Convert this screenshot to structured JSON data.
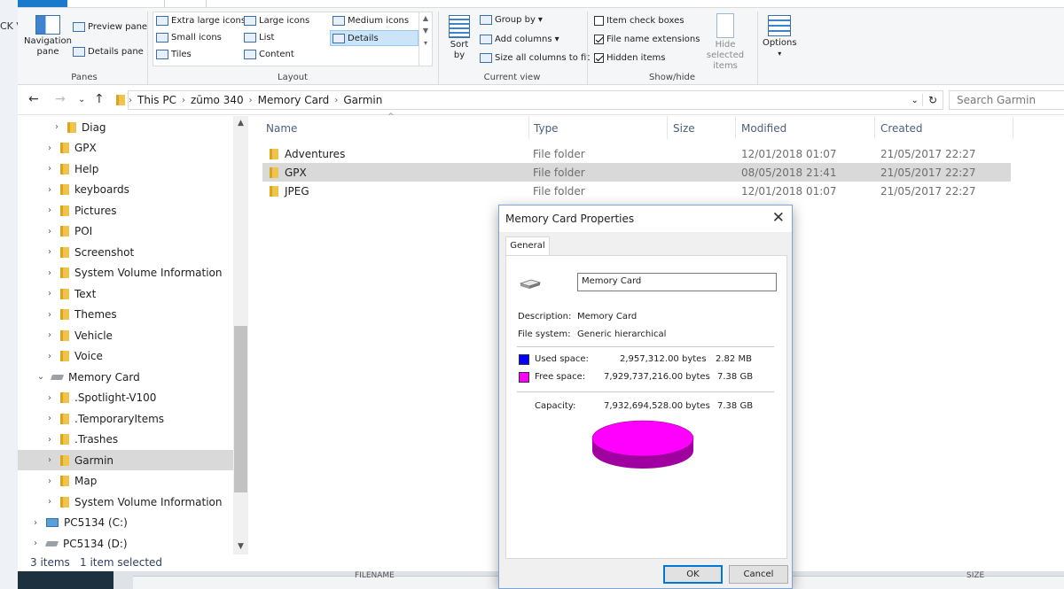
{
  "background": {
    "left_text": "CK V",
    "strip_left": "FILENAME",
    "strip_right": "SIZE"
  },
  "ribbon": {
    "panes": {
      "navigation_pane": "Navigation pane",
      "preview_pane": "Preview pane",
      "details_pane": "Details pane",
      "group_label": "Panes"
    },
    "layout": {
      "extra_large_icons": "Extra large icons",
      "large_icons": "Large icons",
      "medium_icons": "Medium icons",
      "small_icons": "Small icons",
      "list": "List",
      "details": "Details",
      "tiles": "Tiles",
      "content": "Content",
      "group_label": "Layout"
    },
    "current_view": {
      "sort_by": "Sort by",
      "group_by": "Group by",
      "add_columns": "Add columns",
      "size_all_columns": "Size all columns to fit",
      "group_label": "Current view"
    },
    "show_hide": {
      "item_check_boxes": "Item check boxes",
      "file_name_extensions": "File name extensions",
      "hidden_items": "Hidden items",
      "hide_selected_items": "Hide selected items",
      "group_label": "Show/hide",
      "item_check_boxes_checked": false,
      "file_name_extensions_checked": true,
      "hidden_items_checked": true
    },
    "options": "Options"
  },
  "address": {
    "crumbs": [
      "This PC",
      "zūmo 340",
      "Memory Card",
      "Garmin"
    ],
    "search_placeholder": "Search Garmin"
  },
  "tree": [
    {
      "label": "Diag",
      "type": "folder",
      "indent": 2
    },
    {
      "label": "GPX",
      "type": "folder",
      "indent": 1
    },
    {
      "label": "Help",
      "type": "folder",
      "indent": 1
    },
    {
      "label": "keyboards",
      "type": "folder",
      "indent": 1
    },
    {
      "label": "Pictures",
      "type": "folder",
      "indent": 1
    },
    {
      "label": "POI",
      "type": "folder",
      "indent": 1
    },
    {
      "label": "Screenshot",
      "type": "folder",
      "indent": 1
    },
    {
      "label": "System Volume Information",
      "type": "folder",
      "indent": 1
    },
    {
      "label": "Text",
      "type": "folder",
      "indent": 1
    },
    {
      "label": "Themes",
      "type": "folder",
      "indent": 1
    },
    {
      "label": "Vehicle",
      "type": "folder",
      "indent": 1
    },
    {
      "label": "Voice",
      "type": "folder",
      "indent": 1
    },
    {
      "label": "Memory Card",
      "type": "drive",
      "indent": 0,
      "expanded": true
    },
    {
      "label": ".Spotlight-V100",
      "type": "folder",
      "indent": 1
    },
    {
      "label": ".TemporaryItems",
      "type": "folder",
      "indent": 1
    },
    {
      "label": ".Trashes",
      "type": "folder",
      "indent": 1
    },
    {
      "label": "Garmin",
      "type": "folder",
      "indent": 1,
      "selected": true
    },
    {
      "label": "Map",
      "type": "folder",
      "indent": 1
    },
    {
      "label": "System Volume Information",
      "type": "folder",
      "indent": 1
    },
    {
      "label": "PC5134 (C:)",
      "type": "pc",
      "indent": -1
    },
    {
      "label": "PC5134 (D:)",
      "type": "drive",
      "indent": -1
    }
  ],
  "columns": {
    "name": "Name",
    "type": "Type",
    "size": "Size",
    "modified": "Modified",
    "created": "Created"
  },
  "files": [
    {
      "name": "Adventures",
      "type": "File folder",
      "size": "",
      "modified": "12/01/2018 01:07",
      "created": "21/05/2017 22:27"
    },
    {
      "name": "GPX",
      "type": "File folder",
      "size": "",
      "modified": "08/05/2018 21:41",
      "created": "21/05/2017 22:27",
      "selected": true
    },
    {
      "name": "JPEG",
      "type": "File folder",
      "size": "",
      "modified": "12/01/2018 01:07",
      "created": "21/05/2017 22:27"
    }
  ],
  "status": {
    "items": "3 items",
    "selected": "1 item selected"
  },
  "dialog": {
    "title": "Memory Card Properties",
    "tab": "General",
    "name_value": "Memory Card",
    "description_label": "Description:",
    "description_value": "Memory Card",
    "filesystem_label": "File system:",
    "filesystem_value": "Generic hierarchical",
    "used_label": "Used space:",
    "used_bytes": "2,957,312.00 bytes",
    "used_size": "2.82 MB",
    "used_color": "#0000ff",
    "free_label": "Free space:",
    "free_bytes": "7,929,737,216.00 bytes",
    "free_size": "7.38 GB",
    "free_color": "#ff00ff",
    "capacity_label": "Capacity:",
    "capacity_bytes": "7,932,694,528.00 bytes",
    "capacity_size": "7.38 GB",
    "ok": "OK",
    "cancel": "Cancel"
  }
}
